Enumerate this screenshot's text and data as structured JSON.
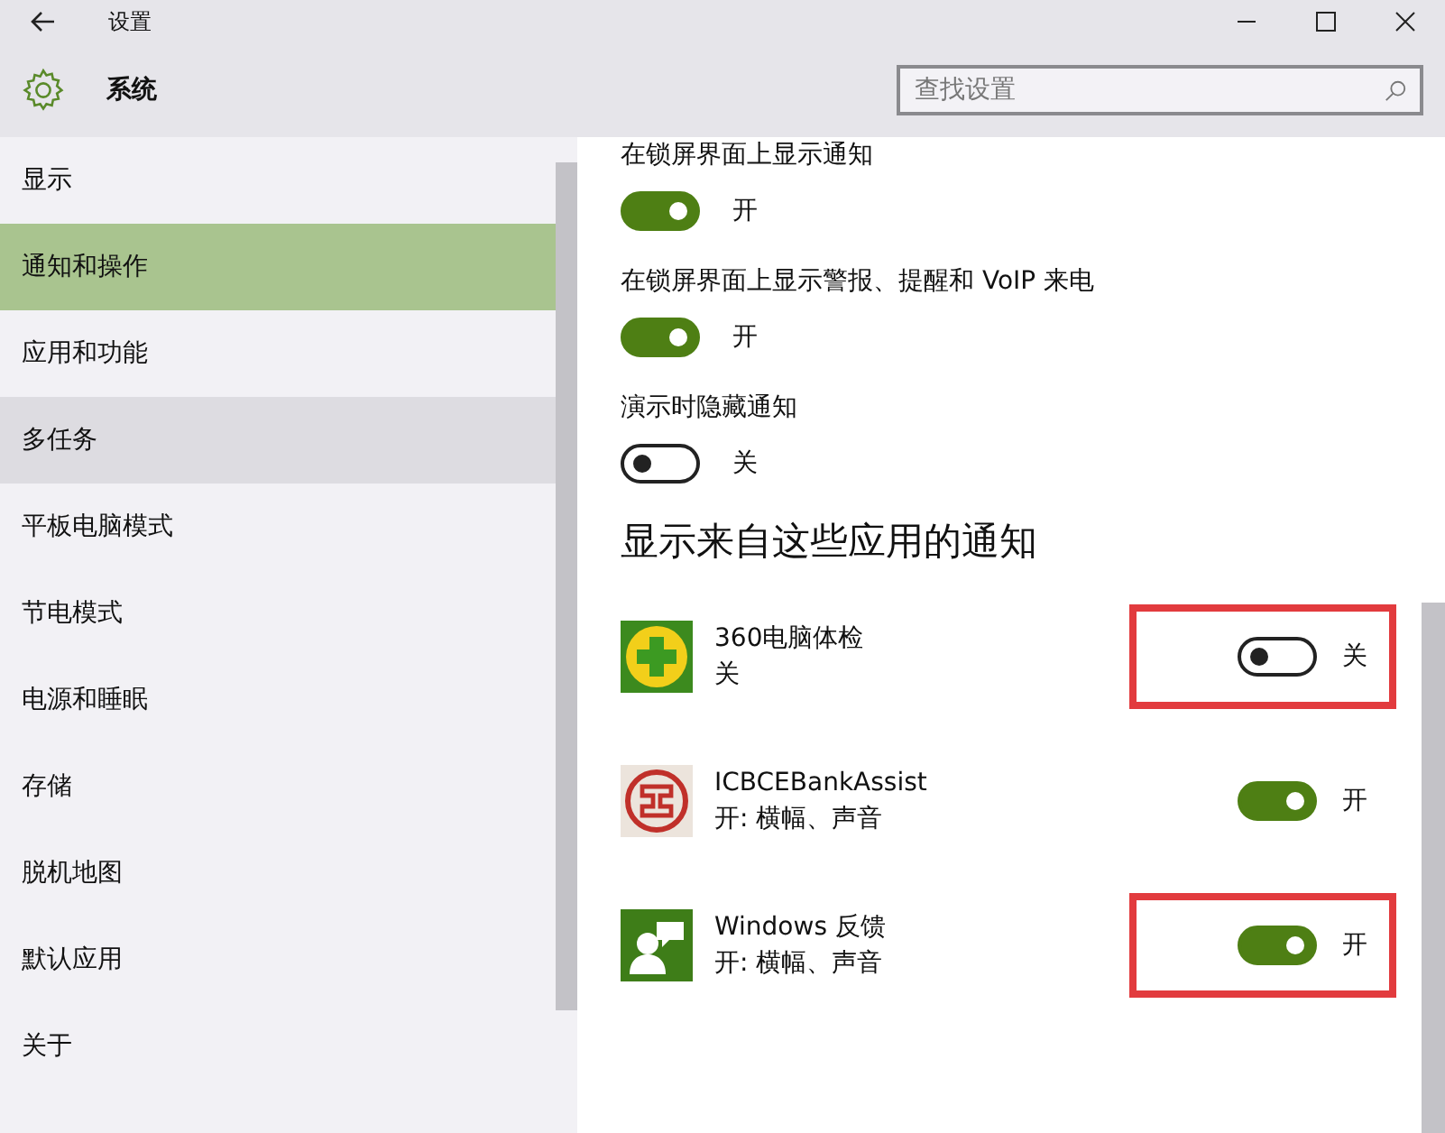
{
  "window": {
    "title": "设置"
  },
  "header": {
    "title": "系统"
  },
  "search": {
    "placeholder": "查找设置"
  },
  "sidebar": {
    "items": [
      {
        "label": "显示",
        "selected": false,
        "hovered": false
      },
      {
        "label": "通知和操作",
        "selected": true,
        "hovered": false
      },
      {
        "label": "应用和功能",
        "selected": false,
        "hovered": false
      },
      {
        "label": "多任务",
        "selected": false,
        "hovered": true
      },
      {
        "label": "平板电脑模式",
        "selected": false,
        "hovered": false
      },
      {
        "label": "节电模式",
        "selected": false,
        "hovered": false
      },
      {
        "label": "电源和睡眠",
        "selected": false,
        "hovered": false
      },
      {
        "label": "存储",
        "selected": false,
        "hovered": false
      },
      {
        "label": "脱机地图",
        "selected": false,
        "hovered": false
      },
      {
        "label": "默认应用",
        "selected": false,
        "hovered": false
      },
      {
        "label": "关于",
        "selected": false,
        "hovered": false
      }
    ]
  },
  "settings": [
    {
      "label": "在锁屏界面上显示通知",
      "on": true,
      "state": "开"
    },
    {
      "label": "在锁屏界面上显示警报、提醒和 VoIP 来电",
      "on": true,
      "state": "开"
    },
    {
      "label": "演示时隐藏通知",
      "on": false,
      "state": "关"
    }
  ],
  "apps_section": {
    "heading": "显示来自这些应用的通知",
    "apps": [
      {
        "name": "360电脑体检",
        "detail": "关",
        "kind": "plus",
        "on": false,
        "state": "关",
        "highlighted": true
      },
      {
        "name": "ICBCEBankAssist",
        "detail": "开: 横幅、声音",
        "kind": "bank",
        "on": true,
        "state": "开",
        "highlighted": false
      },
      {
        "name": "Windows 反馈",
        "detail": "开: 横幅、声音",
        "kind": "feedback",
        "on": true,
        "state": "开",
        "highlighted": true
      }
    ]
  }
}
